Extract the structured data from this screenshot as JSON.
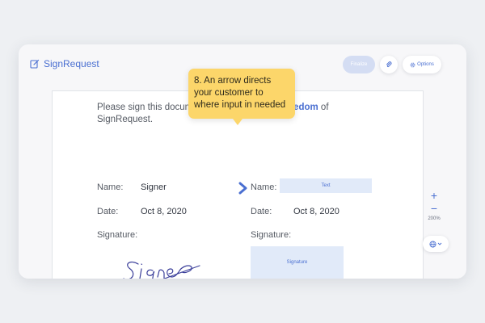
{
  "app": {
    "brand": "SignRequest"
  },
  "toolbar": {
    "finalize_label": "Finalize",
    "options_label": "Options"
  },
  "document": {
    "intro_prefix": "Please sign this docume",
    "intro_hidden_company": "eedom",
    "intro_suffix": " of",
    "intro_line2": "SignRequest.",
    "left": {
      "name_label": "Name:",
      "name_value": "Signer",
      "date_label": "Date:",
      "date_value": "Oct 8, 2020",
      "signature_label": "Signature:"
    },
    "right": {
      "name_label": "Name:",
      "text_field_label": "Text",
      "date_label": "Date:",
      "date_value": "Oct 8, 2020",
      "signature_label": "Signature:",
      "signature_field_label": "Signature"
    }
  },
  "tooltip": {
    "text": "8. An arrow directs your customer to where input in needed"
  },
  "zoom": {
    "in": "+",
    "out": "−",
    "level": "200%"
  },
  "icons": {
    "brand": "edit-document-icon",
    "attach": "paperclip-icon",
    "options": "gear-icon",
    "arrow": "chevron-right-icon",
    "language": "globe-icon"
  },
  "colors": {
    "accent": "#4a6fd1",
    "tooltip": "#fcd66a",
    "field": "#e1eaf9"
  }
}
